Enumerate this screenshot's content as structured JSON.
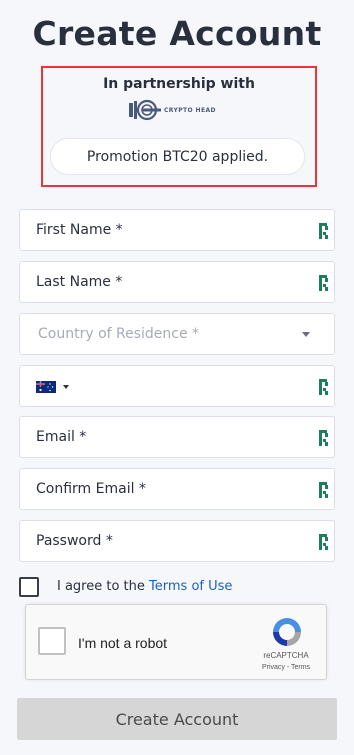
{
  "page": {
    "title": "Create Account"
  },
  "partnership": {
    "label": "In partnership with",
    "logo_text": "CRYPTO HEAD",
    "promo_text": "Promotion BTC20 applied.",
    "highlight_color": "#e8343a"
  },
  "form": {
    "first_name": {
      "label": "First Name *",
      "icon": "key-icon"
    },
    "last_name": {
      "label": "Last Name *",
      "icon": "key-icon"
    },
    "country": {
      "placeholder": "Country of Residence *",
      "icon": "chevron-down-icon"
    },
    "phone": {
      "flag": "australia-flag-icon",
      "icon": "key-icon"
    },
    "email": {
      "label": "Email *",
      "icon": "key-icon"
    },
    "confirm_email": {
      "label": "Confirm Email *",
      "icon": "key-icon"
    },
    "password": {
      "label": "Password *",
      "icon": "key-icon"
    }
  },
  "agree": {
    "text": "I agree to the ",
    "link": "Terms of Use",
    "link_color": "#1a5fc8"
  },
  "captcha": {
    "label": "I'm not a robot",
    "brand": "reCAPTCHA",
    "privacy": "Privacy",
    "separator": " - ",
    "terms": "Terms"
  },
  "submit": {
    "label": "Create Account"
  }
}
